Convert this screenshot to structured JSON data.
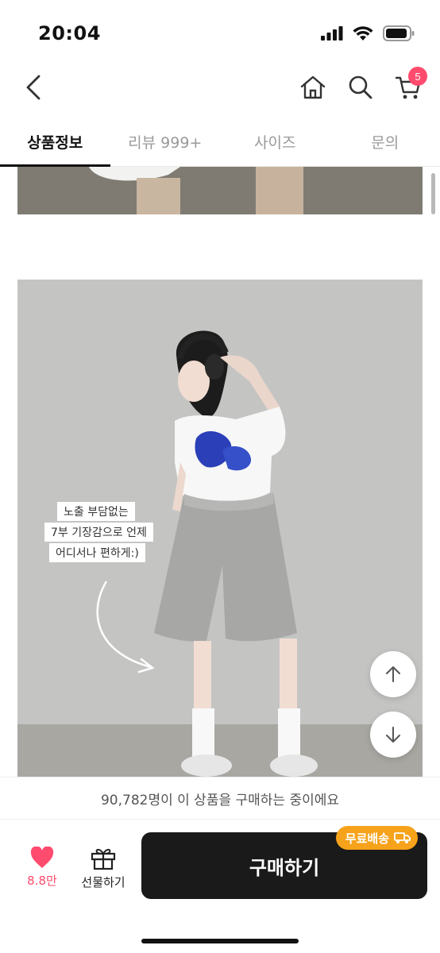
{
  "status_bar": {
    "time": "20:04"
  },
  "header": {
    "cart_count": "5"
  },
  "tabs": [
    {
      "label": "상품정보",
      "active": true
    },
    {
      "label": "리뷰 999+",
      "active": false
    },
    {
      "label": "사이즈",
      "active": false
    },
    {
      "label": "문의",
      "active": false
    }
  ],
  "content": {
    "caption_lines": [
      "노출 부담없는",
      "7부 기장감으로 언제",
      "어디서나 편하게:)"
    ]
  },
  "notice": {
    "text": "90,782명이 이 상품을 구매하는 중이에요"
  },
  "bottom_bar": {
    "like_count": "8.8만",
    "gift_label": "선물하기",
    "buy_label": "구매하기",
    "free_shipping_badge": "무료배송"
  },
  "colors": {
    "accent_pink": "#ff4b6e",
    "shipping_orange": "#f7a21b",
    "button_dark": "#1a1a1a"
  }
}
